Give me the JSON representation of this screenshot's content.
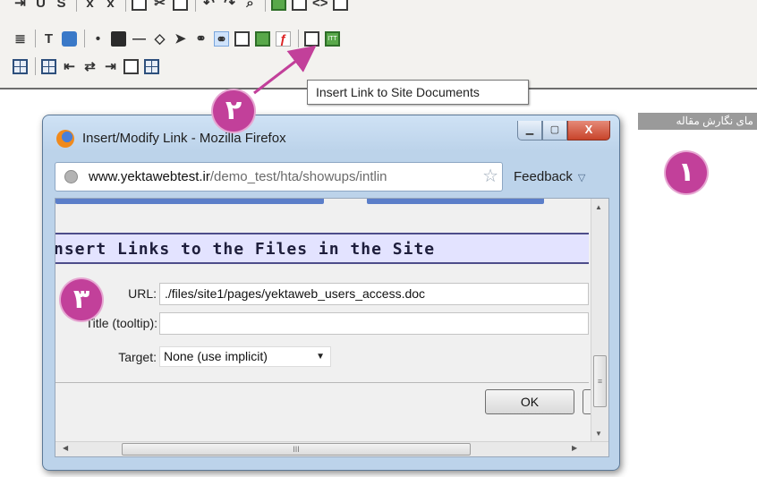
{
  "toolbar": {
    "tooltip": "Insert Link to Site Documents",
    "icons": {
      "row0": [
        "indent-icon",
        "underline-icon",
        "strike-icon",
        "subscript-icon",
        "superscript-icon",
        "copy-icon",
        "cut-icon",
        "paste-icon",
        "undo-icon",
        "redo-icon",
        "find-icon",
        "image-icon",
        "source-icon",
        "text-box-icon"
      ],
      "row1": [
        "right-to-left-icon",
        "text-format-icon",
        "text-color-icon",
        "bullet-icon",
        "box-3d-icon",
        "horizontal-line-icon",
        "toggle-arrows-icon",
        "cursor-arrow-icon",
        "link-icon",
        "site-link-icon",
        "image-insert-icon",
        "picture-icon",
        "flash-icon",
        "frame-icon",
        "number-field-icon"
      ],
      "row2": [
        "table-icon",
        "table-properties-icon",
        "insert-column-icon",
        "move-column-icon",
        "insert-row-icon",
        "cell-icon",
        "grid-icon"
      ]
    },
    "ltr_glyph": "ITT"
  },
  "page": {
    "rtl_snippet": "مای نگارش مقاله"
  },
  "badges": {
    "step1": "۱",
    "step2": "۲",
    "step3": "۳"
  },
  "dialog": {
    "title": "Insert/Modify Link - Mozilla Firefox",
    "url_domain": "www.yektawebtest.ir",
    "url_path": "/demo_test/hta/showups/intlin",
    "url_full": "www.yektawebtest.ir/demo_test/hta/showups/intlin",
    "feedback_label": "Feedback",
    "window_controls": {
      "close": "X"
    },
    "section_title": "nsert Links to the Files in the Site",
    "form": {
      "url_label": "URL:",
      "url_value": "./files/site1/pages/yektaweb_users_access.doc",
      "tooltip_label": "Title (tooltip):",
      "tooltip_value": "",
      "target_label": "Target:",
      "target_value": "None (use implicit)"
    },
    "ok_label": "OK",
    "scroll_grip": "III",
    "vscroll_grip": "≡"
  },
  "colors": {
    "badge": "#c2409a",
    "arrow": "#c2409a",
    "section_header_bg": "#e3e3ff",
    "window_frame": "#bcd3ea",
    "close_button": "#c8442b"
  }
}
